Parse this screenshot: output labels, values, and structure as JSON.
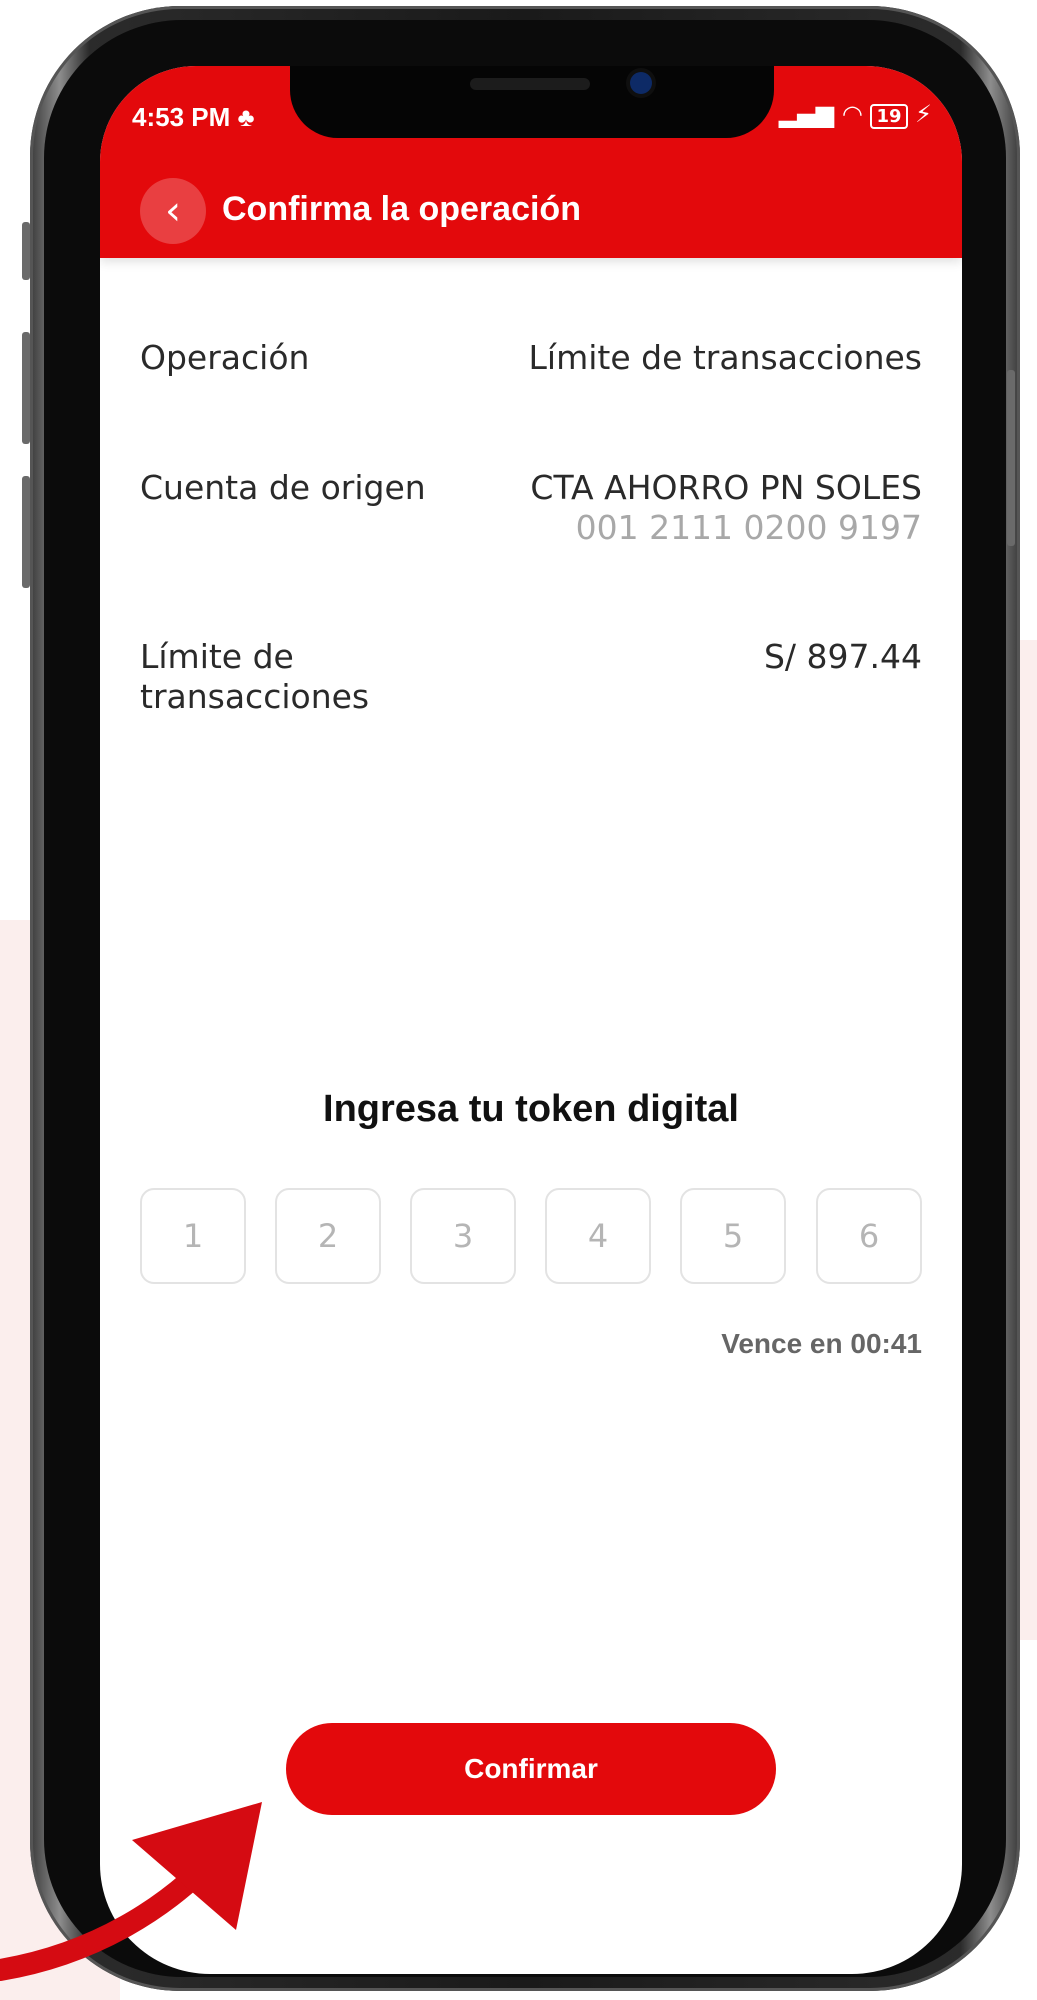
{
  "status_bar": {
    "time": "4:53 PM",
    "incognito_glyph": "♣",
    "right_icons": "▐▐ ◔ 19 ⚡",
    "battery": "19"
  },
  "header": {
    "back_glyph": "‹",
    "title": "Confirma la operación"
  },
  "details": {
    "operation_label": "Operación",
    "operation_value": "Límite de transacciones",
    "account_label": "Cuenta de origen",
    "account_name": "CTA AHORRO PN SOLES",
    "account_number": "001 2111 0200 9197",
    "limit_label_line1": "Límite de",
    "limit_label_line2": "transacciones",
    "limit_value": "S/ 897.44"
  },
  "token": {
    "title": "Ingresa tu token digital",
    "digits": [
      "1",
      "2",
      "3",
      "4",
      "5",
      "6"
    ],
    "expires": "Vence en 00:41"
  },
  "actions": {
    "confirm_label": "Confirmar"
  },
  "colors": {
    "brand_red": "#e3090c",
    "arrow_red": "#d50b12"
  }
}
